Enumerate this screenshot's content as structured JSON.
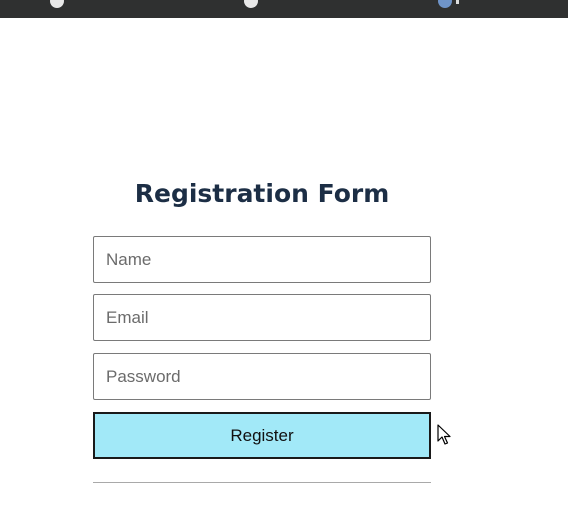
{
  "form": {
    "title": "Registration Form",
    "name_placeholder": "Name",
    "email_placeholder": "Email",
    "password_placeholder": "Password",
    "submit_label": "Register"
  },
  "colors": {
    "title": "#1c2e45",
    "button_bg": "#a2e9f8",
    "topbar_bg": "#2f3030"
  },
  "icons": {
    "cursor": "mouse-pointer-icon"
  }
}
